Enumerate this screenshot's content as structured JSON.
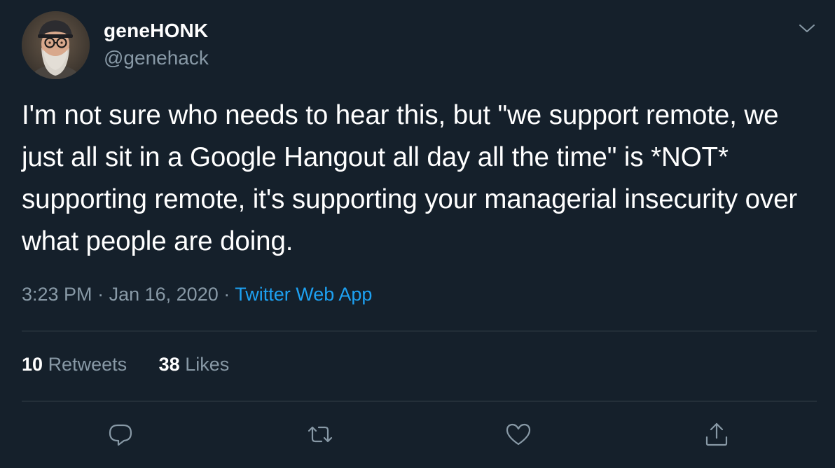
{
  "author": {
    "display_name": "geneHONK",
    "handle": "@genehack"
  },
  "tweet": {
    "text": "I'm not sure who needs to hear this, but \"we support remote, we just all sit in a Google Hangout all day all the time\" is *NOT* supporting remote, it's supporting your managerial insecurity over what people are doing."
  },
  "meta": {
    "time": "3:23 PM",
    "separator": "·",
    "date": "Jan 16, 2020",
    "source": "Twitter Web App"
  },
  "stats": {
    "retweets_count": "10",
    "retweets_label": "Retweets",
    "likes_count": "38",
    "likes_label": "Likes"
  },
  "icons": {
    "more": "chevron-down-icon",
    "reply": "reply-icon",
    "retweet": "retweet-icon",
    "like": "heart-icon",
    "share": "share-icon"
  },
  "colors": {
    "background": "#15202b",
    "primary_text": "#ffffff",
    "secondary_text": "#8899a6",
    "link": "#1da1f2",
    "divider": "#38444d"
  }
}
